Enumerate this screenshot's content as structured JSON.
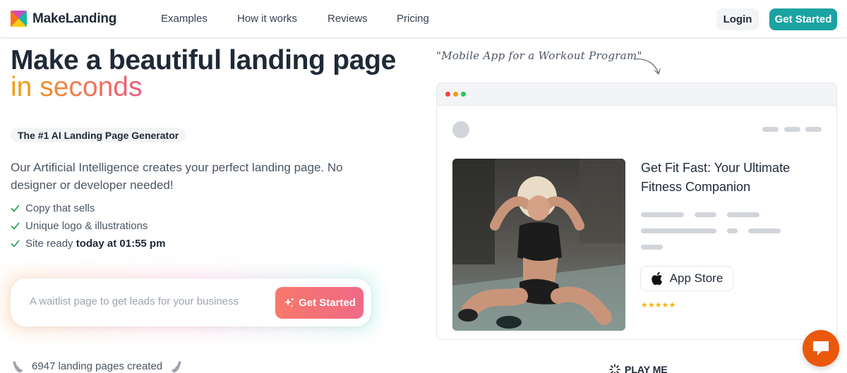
{
  "brand": {
    "name": "MakeLanding",
    "colors": {
      "accent": "#1ba3a3",
      "gradient_start": "#f59e0b",
      "gradient_end": "#ec5a7a",
      "chat": "#ea580c"
    }
  },
  "nav": {
    "items": [
      {
        "label": "Examples"
      },
      {
        "label": "How it works"
      },
      {
        "label": "Reviews"
      },
      {
        "label": "Pricing"
      }
    ],
    "login_label": "Login",
    "get_started_label": "Get Started"
  },
  "hero": {
    "title_line1": "Make a beautiful landing page",
    "title_line2": "in seconds",
    "badge": "The #1 AI Landing Page Generator",
    "description": "Our Artificial Intelligence creates your perfect landing page. No designer or developer needed!",
    "features": [
      {
        "text": "Copy that sells",
        "bold": ""
      },
      {
        "text": "Unique logo & illustrations",
        "bold": ""
      },
      {
        "text": "Site ready ",
        "bold": "today at 01:55 pm"
      }
    ],
    "input_placeholder": "A waitlist page to get leads for your business",
    "generate_label": "Get Started",
    "counter": "6947 landing pages created"
  },
  "preview": {
    "note": "\"Mobile App for a Workout Program\"",
    "mock_title": "Get Fit Fast: Your Ultimate Fitness Companion",
    "appstore_label": "App Store",
    "stars": "★★★★★",
    "rating": 5,
    "play_label": "PLAY ME"
  }
}
